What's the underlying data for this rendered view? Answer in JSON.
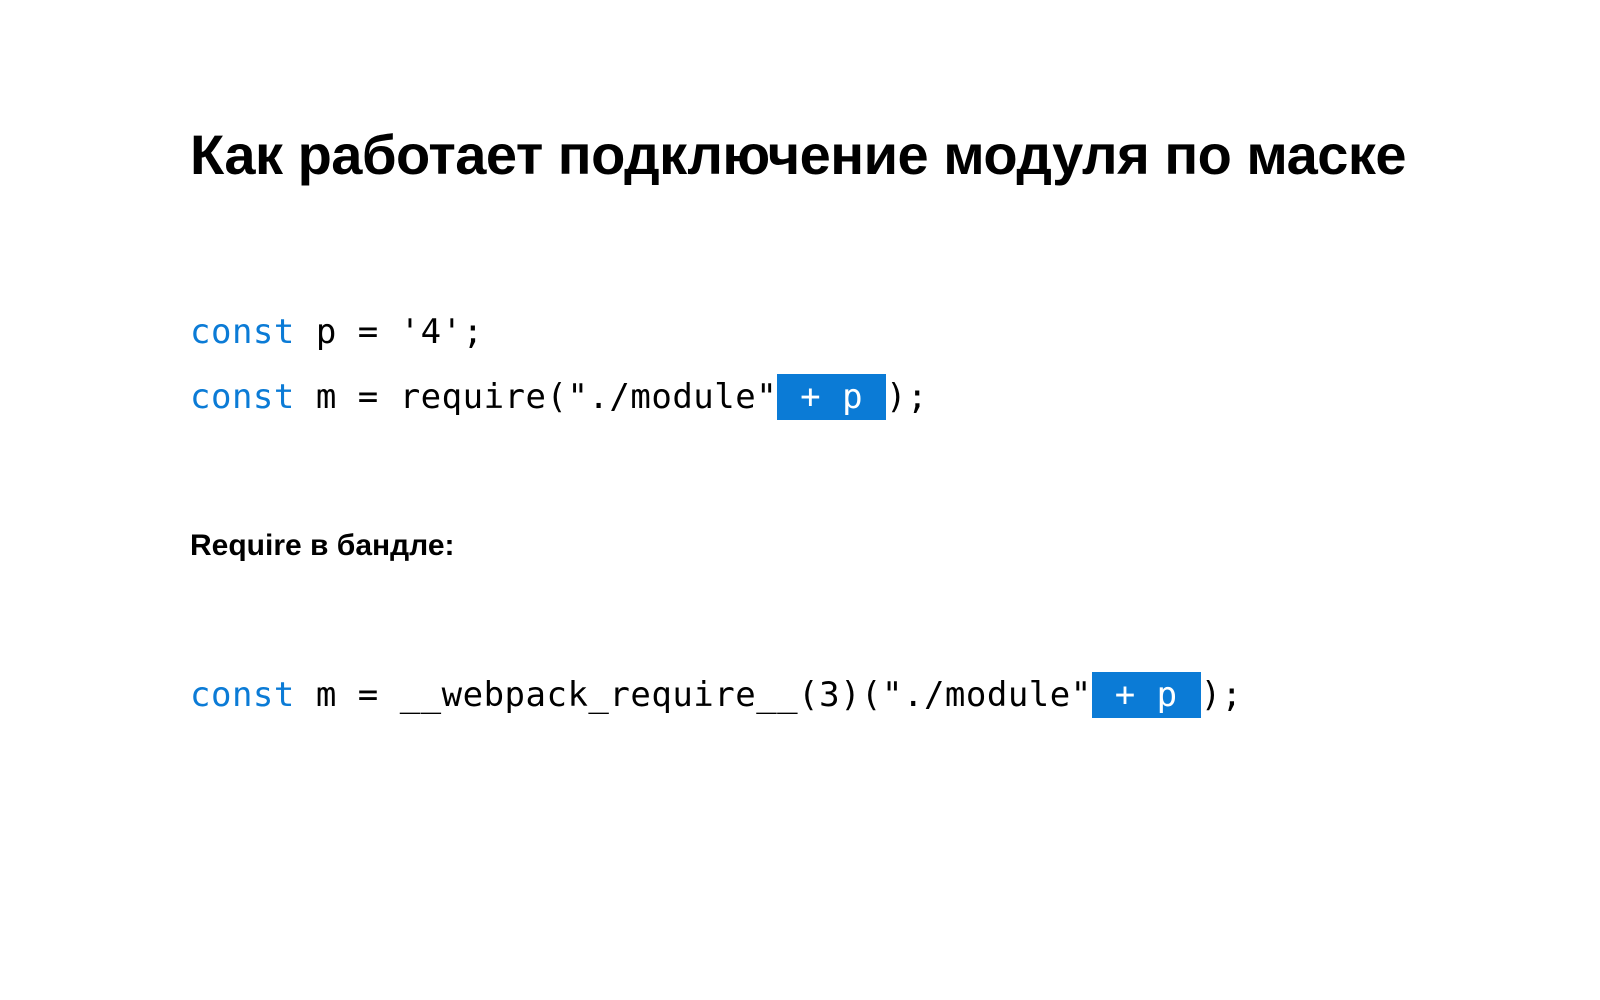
{
  "title": "Как работает подключение модуля по маске",
  "code1": {
    "line1": {
      "kw": "const",
      "rest": " p = '4';"
    },
    "line2": {
      "kw": "const",
      "rest1": " m = require(\"./module\"",
      "hl": " + p ",
      "rest2": ");"
    }
  },
  "subhead": "Require в бандле:",
  "code2": {
    "line1": {
      "kw": "const",
      "rest1": " m = __webpack_require__(3)(\"./module\"",
      "hl": " + p ",
      "rest2": ");"
    }
  }
}
